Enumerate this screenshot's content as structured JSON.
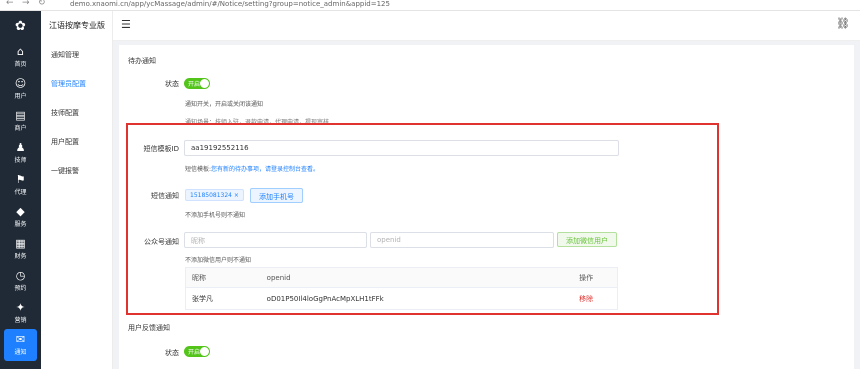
{
  "browser": {
    "url": "demo.xnaomi.cn/app/ycMassage/admin/#/Notice/setting?group=notice_admin&appid=125"
  },
  "rail": {
    "items": [
      {
        "label": "首页",
        "icon": "⌂",
        "active": false
      },
      {
        "label": "用户",
        "icon": "☺",
        "active": false
      },
      {
        "label": "商户",
        "icon": "▤",
        "active": false
      },
      {
        "label": "技师",
        "icon": "♟",
        "active": false
      },
      {
        "label": "代理",
        "icon": "⚑",
        "active": false
      },
      {
        "label": "服务",
        "icon": "◆",
        "active": false
      },
      {
        "label": "财务",
        "icon": "▦",
        "active": false
      },
      {
        "label": "预约",
        "icon": "◷",
        "active": false
      },
      {
        "label": "营销",
        "icon": "✦",
        "active": false
      },
      {
        "label": "通知",
        "icon": "✉",
        "active": true
      }
    ]
  },
  "submenu": {
    "brand": "江语按摩专业版",
    "items": [
      {
        "label": "通知管理",
        "active": false
      },
      {
        "label": "管理员配置",
        "active": true
      },
      {
        "label": "技师配置",
        "active": false
      },
      {
        "label": "用户配置",
        "active": false
      },
      {
        "label": "一键报警",
        "active": false
      }
    ]
  },
  "content": {
    "pending": {
      "title": "待办通知",
      "status_label": "状态",
      "switch_text": "开启",
      "hint1": "通知开关，开启或关闭该通知",
      "hint2": "通知场景：技师入驻，退款申请，代理申请，提现审核"
    },
    "sms": {
      "template_label": "短信模板ID",
      "template_value": "aa19192552116",
      "template_hint_prefix": "短信模板:",
      "template_hint_link": "您有新的待办事项，请登录控制台查看。",
      "notify_label": "短信通知",
      "phone_tag": "15185081324",
      "add_phone_button": "添加手机号",
      "notify_hint": "不添加手机号则不通知"
    },
    "wechat": {
      "label": "公众号通知",
      "nickname_placeholder": "昵称",
      "openid_placeholder": "openid",
      "add_user_button": "添加微信用户",
      "hint": "不添加微信用户则不通知",
      "table_headers": [
        "昵称",
        "openid",
        "操作"
      ],
      "rows": [
        {
          "nickname": "张学凡",
          "openid": "oD01P50Il4loGgPnAcMpXLH1tFFk",
          "action": "移除"
        }
      ]
    },
    "feedback": {
      "title": "用户反馈通知",
      "status_label": "状态",
      "switch_text": "开启"
    }
  }
}
